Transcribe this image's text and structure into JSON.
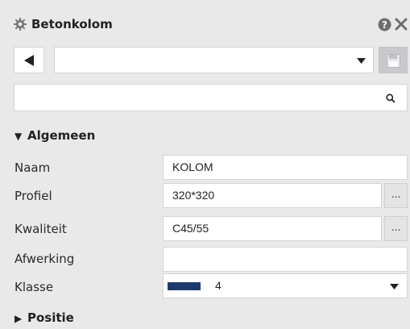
{
  "panel": {
    "title": "Betonkolom",
    "icons": {
      "title": "gear-icon",
      "help": "help-icon",
      "close": "close-icon"
    }
  },
  "toolbar": {
    "back_icon": "triangle-left-icon",
    "preset_value": "",
    "save_icon": "floppy-disk-icon"
  },
  "search": {
    "value": "",
    "icon": "magnifier-icon"
  },
  "sections": {
    "algemeen": {
      "label": "Algemeen",
      "expanded": true
    },
    "positie": {
      "label": "Positie",
      "expanded": false
    }
  },
  "properties": {
    "naam": {
      "label": "Naam",
      "value": "KOLOM"
    },
    "profiel": {
      "label": "Profiel",
      "value": "320*320",
      "button": "..."
    },
    "kwaliteit": {
      "label": "Kwaliteit",
      "value": "C45/55",
      "button": "..."
    },
    "afwerking": {
      "label": "Afwerking",
      "value": ""
    },
    "klasse": {
      "label": "Klasse",
      "value": "4",
      "swatch_color": "#1f3a6e"
    }
  },
  "colors": {
    "background": "#e9e9e9",
    "field_border": "#d4d4d4",
    "disabled_button": "#c9c9cd"
  }
}
